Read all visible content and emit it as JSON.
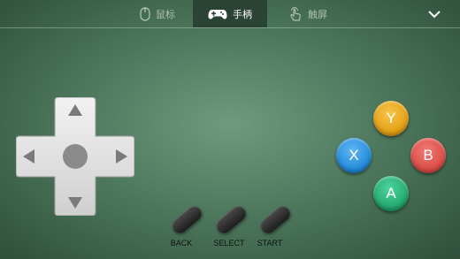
{
  "tabs": {
    "mouse": {
      "label": "鼠标",
      "icon": "mouse-icon"
    },
    "gamepad": {
      "label": "手柄",
      "icon": "gamepad-icon",
      "active": true
    },
    "touch": {
      "label": "触屏",
      "icon": "touch-icon"
    }
  },
  "header": {
    "collapse_icon": "chevron-down-icon"
  },
  "dpad": {
    "icons": [
      "arrow-up-icon",
      "arrow-down-icon",
      "arrow-left-icon",
      "arrow-right-icon",
      "dpad-center"
    ]
  },
  "face_buttons": {
    "y": {
      "label": "Y",
      "color": "#e8a51a"
    },
    "x": {
      "label": "X",
      "color": "#2490e0"
    },
    "b": {
      "label": "B",
      "color": "#de504a"
    },
    "a": {
      "label": "A",
      "color": "#22a86f"
    }
  },
  "system_buttons": {
    "back": "BACK",
    "select": "SELECT",
    "start": "START"
  },
  "colors": {
    "background": "#4f7a5f",
    "active_tab": "#2b4334"
  }
}
